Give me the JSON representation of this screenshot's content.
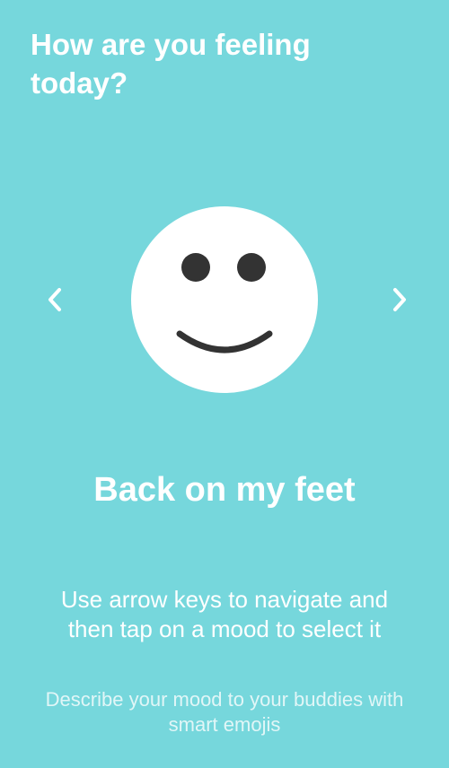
{
  "header": {
    "title": "How are you feeling today?"
  },
  "mood": {
    "icon": "smiley-face-icon",
    "label": "Back on my feet"
  },
  "navigation": {
    "prev_icon": "chevron-left-icon",
    "next_icon": "chevron-right-icon"
  },
  "instructions": {
    "text": "Use arrow keys to navigate and then tap on a mood to select it"
  },
  "footer": {
    "subtext": "Describe your mood to your buddies with smart emojis"
  },
  "colors": {
    "background": "#76D7DC",
    "text": "#FFFFFF",
    "face": "#FFFFFF",
    "face_features": "#333333"
  }
}
